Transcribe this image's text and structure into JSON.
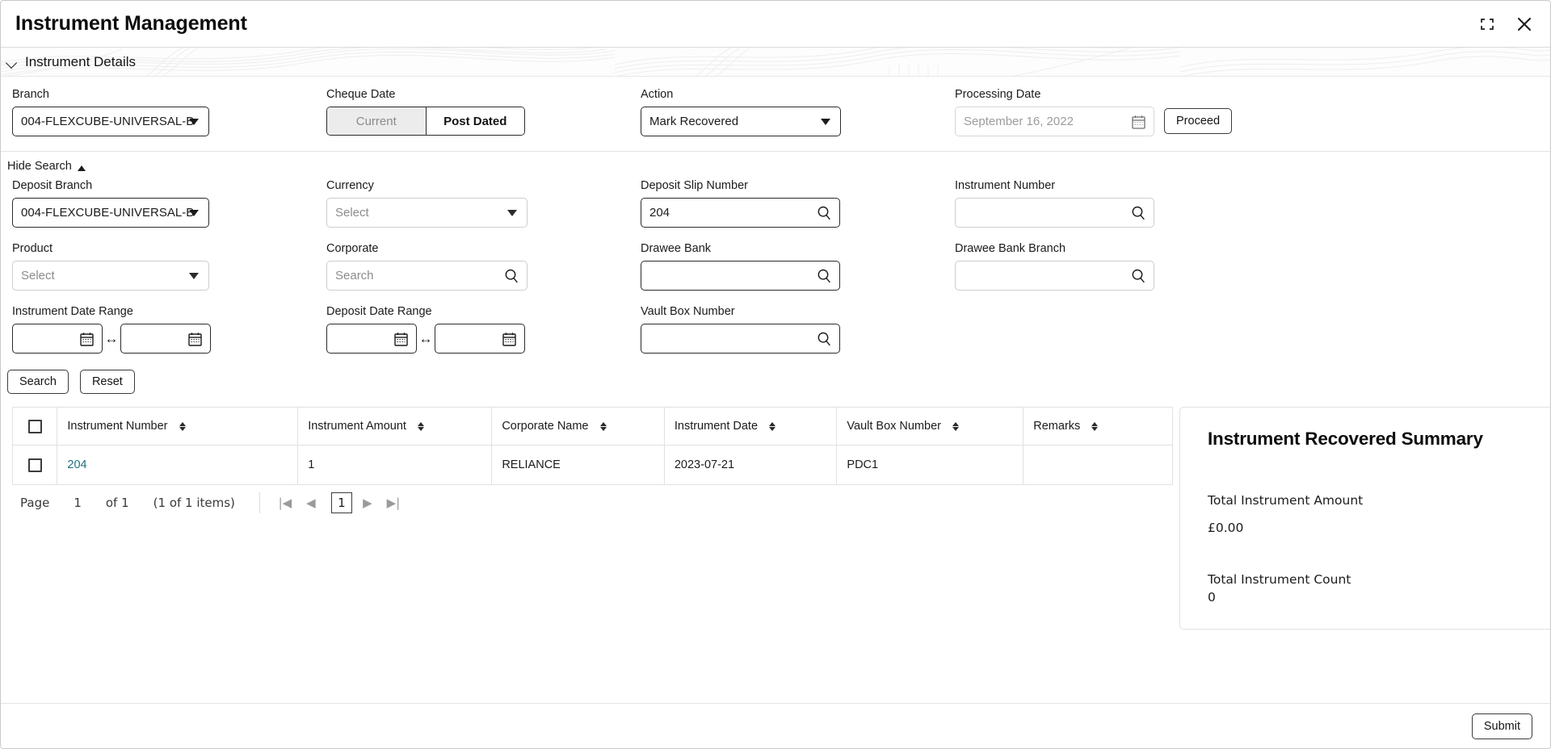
{
  "window": {
    "title": "Instrument Management",
    "minimize_icon": "collapse-icon",
    "close_icon": "close-icon"
  },
  "section": {
    "title": "Instrument Details",
    "collapse_icon": "chevron-down-icon"
  },
  "details": {
    "branch": {
      "label": "Branch",
      "value": "004-FLEXCUBE-UNIVERSAL-B"
    },
    "cheque_date": {
      "label": "Cheque Date",
      "options": [
        "Current",
        "Post Dated"
      ],
      "selected": "Post Dated"
    },
    "action": {
      "label": "Action",
      "value": "Mark Recovered"
    },
    "processing_date": {
      "label": "Processing Date",
      "value": "September 16, 2022",
      "icon": "calendar-icon"
    },
    "proceed_label": "Proceed"
  },
  "search_panel": {
    "toggle_label": "Hide Search",
    "toggle_icon": "chevron-up-icon",
    "deposit_branch": {
      "label": "Deposit Branch",
      "value": "004-FLEXCUBE-UNIVERSAL-B"
    },
    "currency": {
      "label": "Currency",
      "placeholder": "Select",
      "value": "Select"
    },
    "deposit_slip_number": {
      "label": "Deposit Slip Number",
      "value": "204",
      "icon": "search-icon"
    },
    "instrument_number": {
      "label": "Instrument Number",
      "value": "",
      "icon": "search-icon"
    },
    "product": {
      "label": "Product",
      "placeholder": "Select",
      "value": "Select"
    },
    "corporate": {
      "label": "Corporate",
      "placeholder": "Search",
      "value": "Search",
      "icon": "search-icon"
    },
    "drawee_bank": {
      "label": "Drawee Bank",
      "value": "",
      "icon": "search-icon"
    },
    "drawee_bank_branch": {
      "label": "Drawee Bank Branch",
      "value": "",
      "icon": "search-icon"
    },
    "instrument_date_range": {
      "label": "Instrument Date Range",
      "from": "",
      "to": "",
      "separator": "↔",
      "icon": "calendar-icon"
    },
    "deposit_date_range": {
      "label": "Deposit Date Range",
      "from": "",
      "to": "",
      "separator": "↔",
      "icon": "calendar-icon"
    },
    "vault_box_number": {
      "label": "Vault Box Number",
      "value": "",
      "icon": "search-icon"
    },
    "search_label": "Search",
    "reset_label": "Reset"
  },
  "table": {
    "columns": [
      "Instrument Number",
      "Instrument Amount",
      "Corporate Name",
      "Instrument Date",
      "Vault Box Number",
      "Remarks"
    ],
    "rows": [
      {
        "instrument_number": "204",
        "instrument_amount": "1",
        "corporate_name": "RELIANCE",
        "instrument_date": "2023-07-21",
        "vault_box_number": "PDC1",
        "remarks": ""
      }
    ]
  },
  "pagination": {
    "page_label": "Page",
    "page_number": "1",
    "of_label": "of 1",
    "items_label": "(1 of 1 items)",
    "first_icon": "|◀",
    "prev_icon": "◀",
    "current_page": "1",
    "next_icon": "▶",
    "last_icon": "▶|"
  },
  "summary": {
    "title": "Instrument Recovered Summary",
    "total_amount_label": "Total Instrument Amount",
    "total_amount_value": "£0.00",
    "total_count_label": "Total Instrument Count",
    "total_count_value": "0"
  },
  "footer": {
    "submit_label": "Submit"
  },
  "colors": {
    "link": "#1d6f82",
    "border": "#2b2b2b",
    "border_light": "#cdcdcd",
    "toggle_inactive_bg": "#ececec",
    "text": "#1b1b1b"
  }
}
